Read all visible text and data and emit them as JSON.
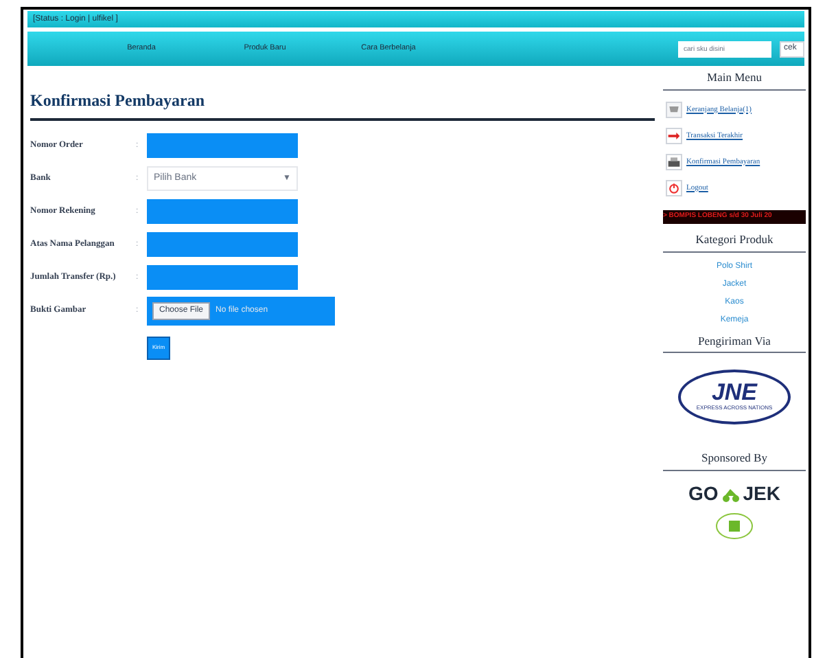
{
  "status_bar": "[Status : Login | ulfikel ]",
  "nav": {
    "items": [
      {
        "label": "Beranda"
      },
      {
        "label": "Produk Baru"
      },
      {
        "label": "Cara Berbelanja"
      }
    ],
    "search": {
      "placeholder": "cari sku disini"
    },
    "search_button": "cek"
  },
  "heading": "Konfirmasi Pembayaran",
  "form": {
    "fields": [
      {
        "kind": "text",
        "label": "Nomor Order",
        "separator": ":"
      },
      {
        "kind": "select",
        "label": "Bank",
        "separator": ":",
        "value": "Pilih Bank",
        "caret": "▼"
      },
      {
        "kind": "text",
        "label": "Nomor Rekening",
        "separator": ":"
      },
      {
        "kind": "text",
        "label": "Atas Nama Pelanggan",
        "separator": ":"
      },
      {
        "kind": "text",
        "label": "Jumlah Transfer (Rp.)",
        "separator": ":"
      },
      {
        "kind": "file",
        "label": "Bukti Gambar",
        "separator": ":",
        "button": "Choose File",
        "value": "No file chosen"
      }
    ],
    "submit": "Kirim"
  },
  "sidebar": {
    "main_menu": {
      "title": "Main Menu",
      "items": [
        {
          "label": "Keranjang Belanja(1)"
        },
        {
          "label": "Transaksi Terakhir"
        },
        {
          "label": "Konfirmasi Pembayaran"
        },
        {
          "label": "Logout"
        }
      ]
    },
    "ticker": "> BOMPIS LOBENG s/d 30 Juli 20",
    "categories": {
      "title": "Kategori Produk",
      "items": [
        "Polo Shirt",
        "Jacket",
        "Kaos",
        "Kemeja"
      ]
    },
    "shipping": {
      "title": "Pengiriman Via",
      "logo": "JNE",
      "tagline": "EXPRESS ACROSS NATIONS"
    },
    "sponsor": {
      "title": "Sponsored By",
      "logo_left": "GO",
      "logo_right": "JEK"
    }
  }
}
